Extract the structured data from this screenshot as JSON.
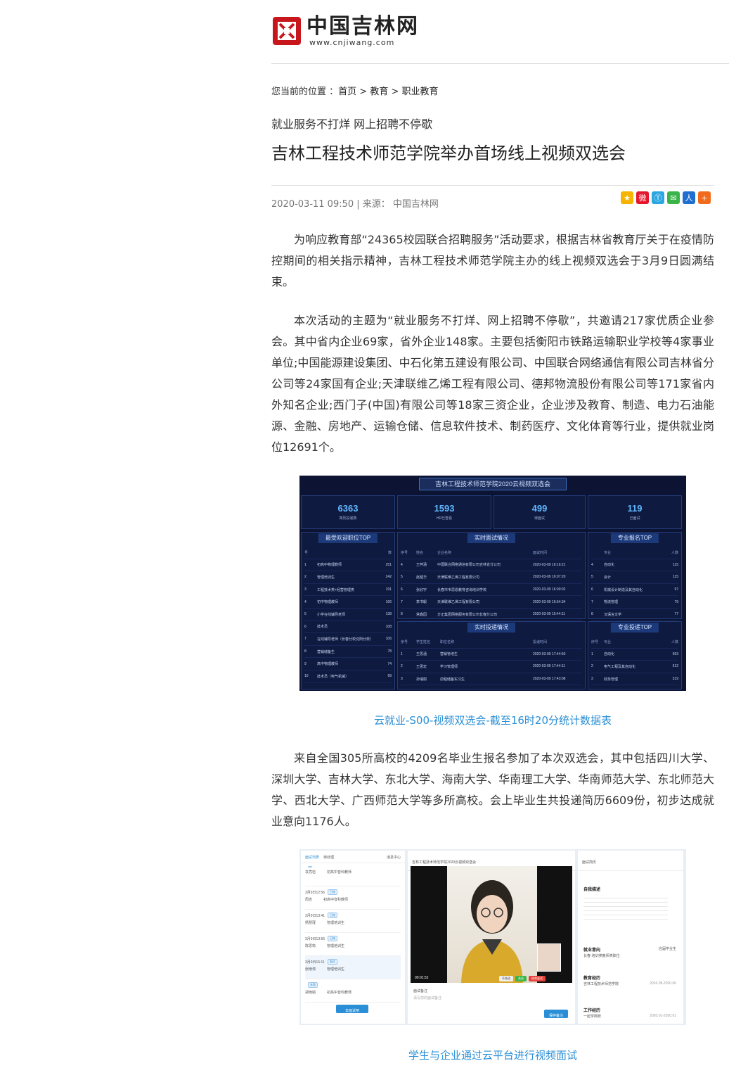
{
  "site": {
    "logo_text": "中国吉林网",
    "logo_url": "www.cnjiwang.com"
  },
  "breadcrumb": {
    "prefix": "您当前的位置 ：",
    "items": [
      "首页",
      "教育",
      "职业教育"
    ],
    "separator": ">"
  },
  "article": {
    "subtitle": "就业服务不打烊 网上招聘不停歇",
    "title": "吉林工程技术师范学院举办首场线上视频双选会",
    "meta": "2020-03-11 09:50 | 来源： 中国吉林网",
    "paragraphs": [
      "为响应教育部“24365校园联合招聘服务”活动要求，根据吉林省教育厅关于在疫情防控期间的相关指示精神，吉林工程技术师范学院主办的线上视频双选会于3月9日圆满结束。",
      "本次活动的主题为“就业服务不打烊、网上招聘不停歇”，共邀请217家优质企业参会。其中省内企业69家，省外企业148家。主要包括衡阳市铁路运输职业学校等4家事业单位;中国能源建设集团、中石化第五建设有限公司、中国联合网络通信有限公司吉林省分公司等24家国有企业;天津联维乙烯工程有限公司、德邦物流股份有限公司等171家省内外知名企业;西门子(中国)有限公司等18家三资企业，企业涉及教育、制造、电力石油能源、金融、房地产、运输仓储、信息软件技术、制药医疗、文化体育等行业，提供就业岗位12691个。",
      "来自全国305所高校的4209名毕业生报名参加了本次双选会，其中包括四川大学、深圳大学、吉林大学、东北大学、海南大学、华南理工大学、华南师范大学、东北师范大学、西北大学、广西师范大学等多所高校。会上毕业生共投递简历6609份，初步达成就业意向1176人。"
    ],
    "caption1": "云就业-S00-视频双选会-截至16时20分统计数据表",
    "caption2": "学生与企业通过云平台进行视频面试"
  },
  "share_icons": [
    "qzone-icon",
    "weibo-icon",
    "tencent-weibo-icon",
    "wechat-icon",
    "renren-icon",
    "more-share-icon"
  ],
  "dashboard": {
    "title": "吉林工程技术师范学院2020云视频双选会",
    "kpis": [
      {
        "value": "6363",
        "label": "简历投递数"
      },
      {
        "value": "1593",
        "label": "HR已查看"
      },
      {
        "value": "499",
        "label": "待面试"
      },
      {
        "value": "119",
        "label": "已面试"
      }
    ],
    "top_jobs": {
      "title": "最受欢迎职位TOP",
      "header": [
        "号",
        "",
        "数"
      ],
      "rows": [
        [
          "1",
          "初高中物理教师",
          "251"
        ],
        [
          "2",
          "管理培训生",
          "242"
        ],
        [
          "3",
          "工程技术类+经营管理类",
          "191"
        ],
        [
          "4",
          "初中物理教师",
          "166"
        ],
        [
          "5",
          "小学在线辅导老师",
          "138"
        ],
        [
          "6",
          "技术员",
          "108"
        ],
        [
          "7",
          "在线辅导老师（长春分校沈阳分校）",
          "106"
        ],
        [
          "8",
          "营销储备生",
          "78"
        ],
        [
          "9",
          "高中物理教师",
          "74"
        ],
        [
          "10",
          "技术员（电气机械）",
          "69"
        ]
      ]
    },
    "live_interviews": {
      "title": "实时面试情况",
      "header": [
        "序号",
        "姓名",
        "企业名称",
        "面试时间"
      ],
      "rows": [
        [
          "4",
          "王梓涵",
          "中国联合网络通信有限公司吉林省分公司",
          "2020-03-09 16:16:21"
        ],
        [
          "5",
          "赵健华",
          "天津联维乙烯工程有限公司",
          "2020-03-09 16:07:20"
        ],
        [
          "6",
          "张欣宇",
          "长春市韦思恩教育咨询培训学校",
          "2020-03-09 16:00:02"
        ],
        [
          "7",
          "李书毅",
          "天津联维乙烯工程有限公司",
          "2020-03-09 15:54:34"
        ],
        [
          "8",
          "常鑫园",
          "方正集团网络服务有限公司长春分公司",
          "2020-03-09 15:44:11"
        ]
      ]
    },
    "live_resumes": {
      "title": "实时投递情况",
      "header": [
        "序号",
        "学生姓名",
        "职位名称",
        "投递时间"
      ],
      "rows": [
        [
          "1",
          "王思涵",
          "营销管培生",
          "2020-03-09 17:44:50"
        ],
        [
          "2",
          "王思宏",
          "学习管理师",
          "2020-03-09 17:44:11"
        ],
        [
          "3",
          "孙瑞丽",
          "前程储备实习生",
          "2020-03-09 17:43:08"
        ]
      ]
    },
    "major_signup": {
      "title": "专业报名TOP",
      "header": [
        "",
        "专业",
        "人数"
      ],
      "rows": [
        [
          "4",
          "自动化",
          "115"
        ],
        [
          "5",
          "会计",
          "115"
        ],
        [
          "6",
          "机械设计制造及其自动化",
          "97"
        ],
        [
          "7",
          "物流管理",
          "79"
        ],
        [
          "8",
          "汉语言文学",
          "77"
        ]
      ]
    },
    "major_resume": {
      "title": "专业投递TOP",
      "header": [
        "序号",
        "专业",
        "人数"
      ],
      "rows": [
        [
          "1",
          "自动化",
          "593"
        ],
        [
          "2",
          "电气工程及其自动化",
          "512"
        ],
        [
          "3",
          "财务管理",
          "319"
        ]
      ]
    }
  },
  "interview_ui": {
    "tabs": [
      "面试列表",
      "待处理"
    ],
    "left_header_right": "消息中心",
    "list": [
      {
        "time": "",
        "status": "",
        "name": "袁亮岩",
        "job": "初高中音科教师"
      },
      {
        "time": "3月9日12:56",
        "status": "已结",
        "name": "周吉",
        "job": "初高中音科教师"
      },
      {
        "time": "3月9日13:41",
        "status": "已结",
        "name": "杨慧瑾",
        "job": "管理培训生"
      },
      {
        "time": "3月9日13:56",
        "status": "已结",
        "name": "陈思筠",
        "job": "管理培训生"
      },
      {
        "time": "3月9日15:11",
        "status": "面试",
        "name": "张雨涛",
        "job": "管理培训生"
      },
      {
        "time": "",
        "status": "未面",
        "name": "郑雨娟",
        "job": "初高中音科教师"
      }
    ],
    "left_button": "去面试吧",
    "video_title": "吉林工程技术师范学院2020云视频双选会",
    "video_time": "00:01:52",
    "buttons": [
      "不合适",
      "合适",
      "结束面试"
    ],
    "notes_label": "面试备注",
    "notes_placeholder": "请写您的面试备注",
    "save_button": "保存备注",
    "resume_title": "面试简历",
    "sections": [
      "自我描述",
      "就业意向",
      "教育经历",
      "工作经历"
    ],
    "school": "吉林工程技术师范学院",
    "edu_dates": "2016.09-2020.06",
    "job_line": "长春·培训类教师类职位",
    "work_line": "一起学网校",
    "work_dates": "2020.01-2020.01",
    "grad_status": "应届毕业生"
  }
}
